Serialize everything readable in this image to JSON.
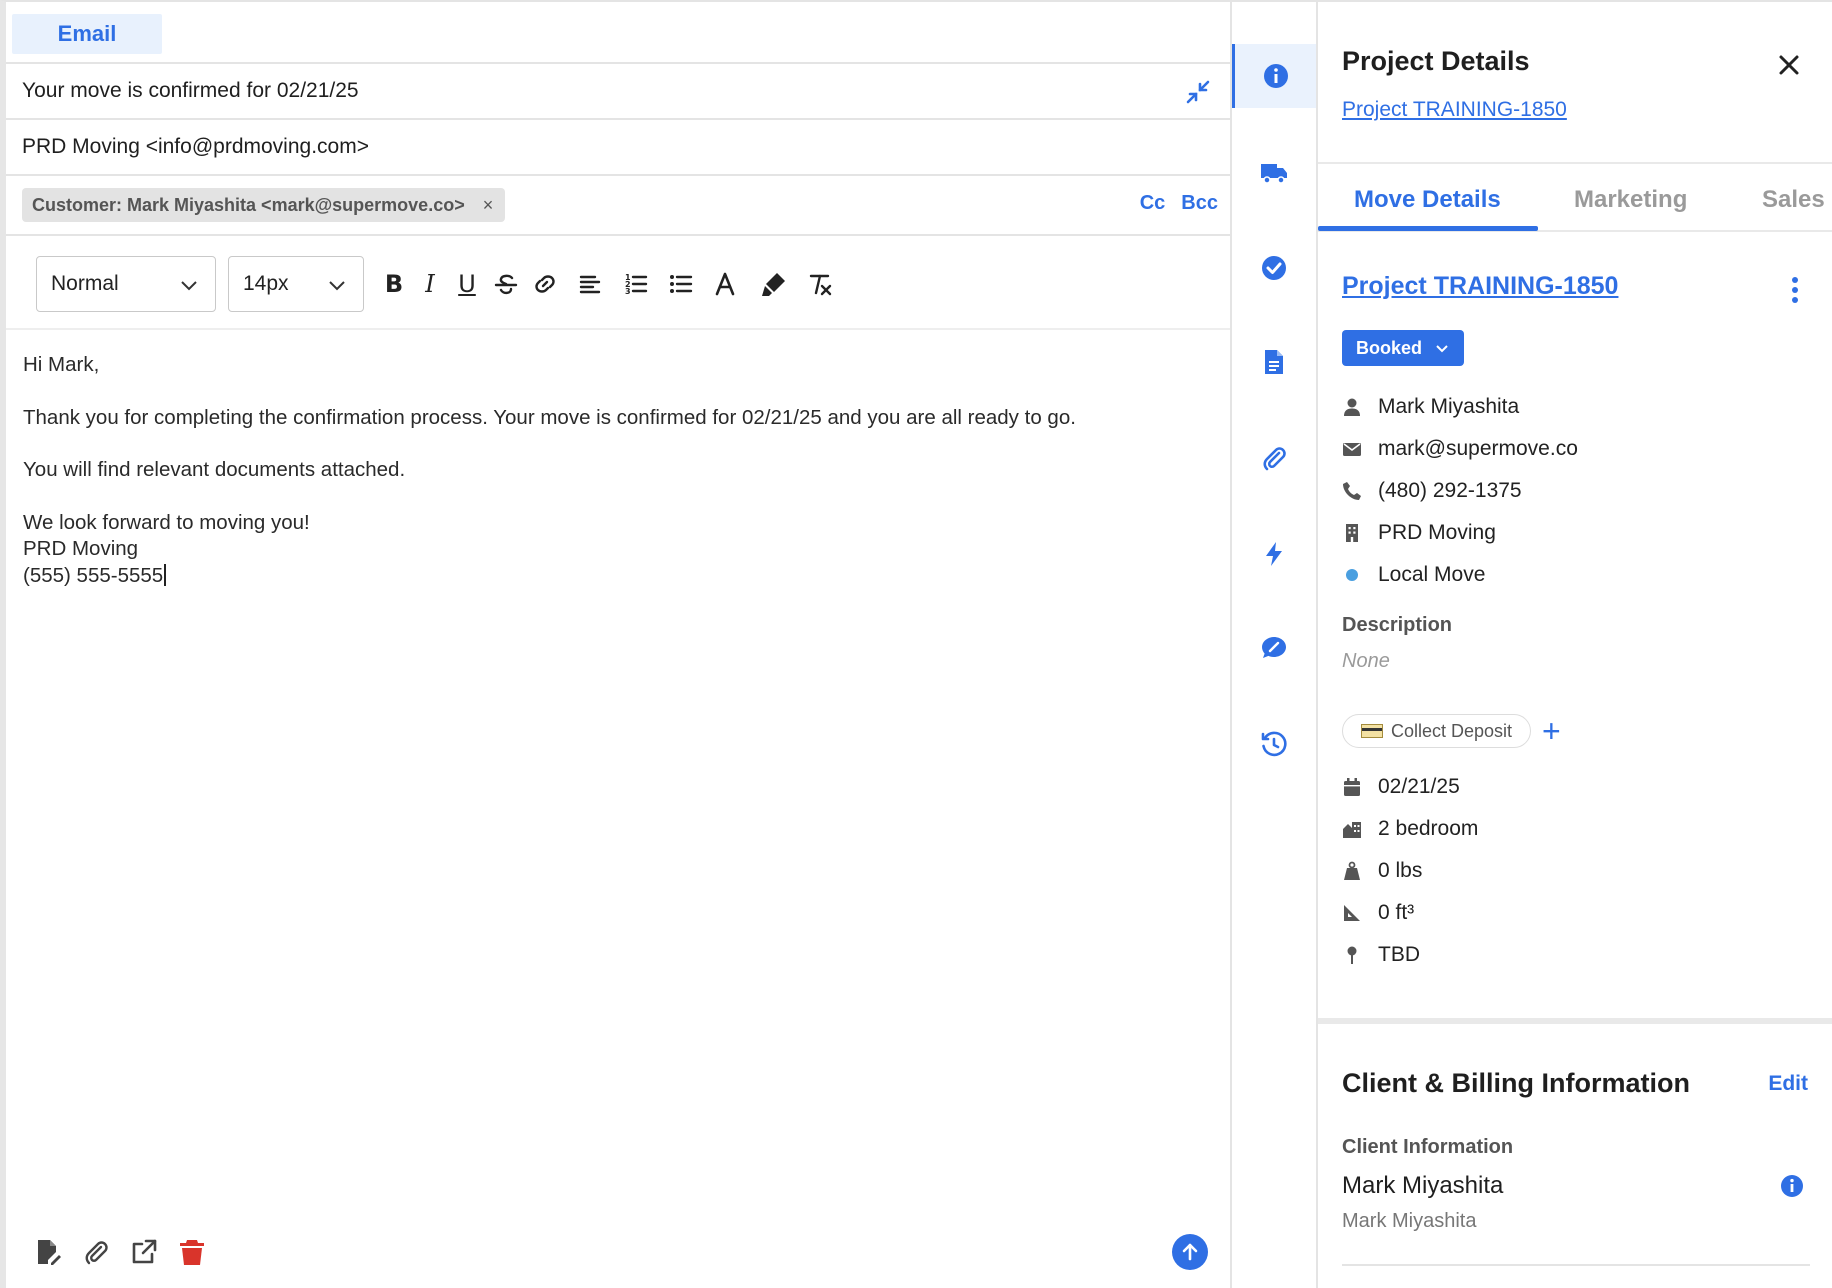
{
  "composer": {
    "tab_label": "Email",
    "subject": "Your move is confirmed for 02/21/25",
    "from": "PRD Moving <info@prdmoving.com>",
    "to_chip": "Customer: Mark Miyashita <mark@supermove.co>",
    "chip_remove": "×",
    "cc_label": "Cc",
    "bcc_label": "Bcc",
    "toolbar": {
      "style_value": "Normal",
      "size_value": "14px",
      "bold": "B",
      "italic": "I",
      "underline": "U"
    },
    "body": {
      "greeting": "Hi Mark,",
      "paragraph1": "Thank you for completing the confirmation process. Your move is confirmed for 02/21/25 and you are all ready to go.",
      "paragraph2": "You will find relevant documents attached.",
      "closing": "We look forward to moving you!",
      "company": "PRD Moving",
      "phone": "(555) 555-5555"
    }
  },
  "details": {
    "title": "Project Details",
    "project_link": "Project TRAINING-1850",
    "tabs": [
      "Move Details",
      "Marketing",
      "Sales"
    ],
    "project_heading": "Project TRAINING-1850",
    "status": "Booked",
    "contact": {
      "name": "Mark Miyashita",
      "email": "mark@supermove.co",
      "phone": "(480) 292-1375",
      "organization": "PRD Moving",
      "move_type": "Local Move"
    },
    "description_label": "Description",
    "description_value": "None",
    "collect_deposit": "Collect Deposit",
    "add_symbol": "+",
    "move": {
      "date": "02/21/25",
      "size": "2 bedroom",
      "weight": "0 lbs",
      "volume": "0 ft³",
      "location": "TBD"
    },
    "billing": {
      "title": "Client & Billing Information",
      "edit_label": "Edit",
      "client_info_label": "Client Information",
      "client_name": "Mark Miyashita",
      "client_contact": "Mark Miyashita"
    }
  },
  "colors": {
    "accent": "#2f6fe4",
    "move_type_dot": "#4a9fe0",
    "delete": "#d9342b"
  }
}
